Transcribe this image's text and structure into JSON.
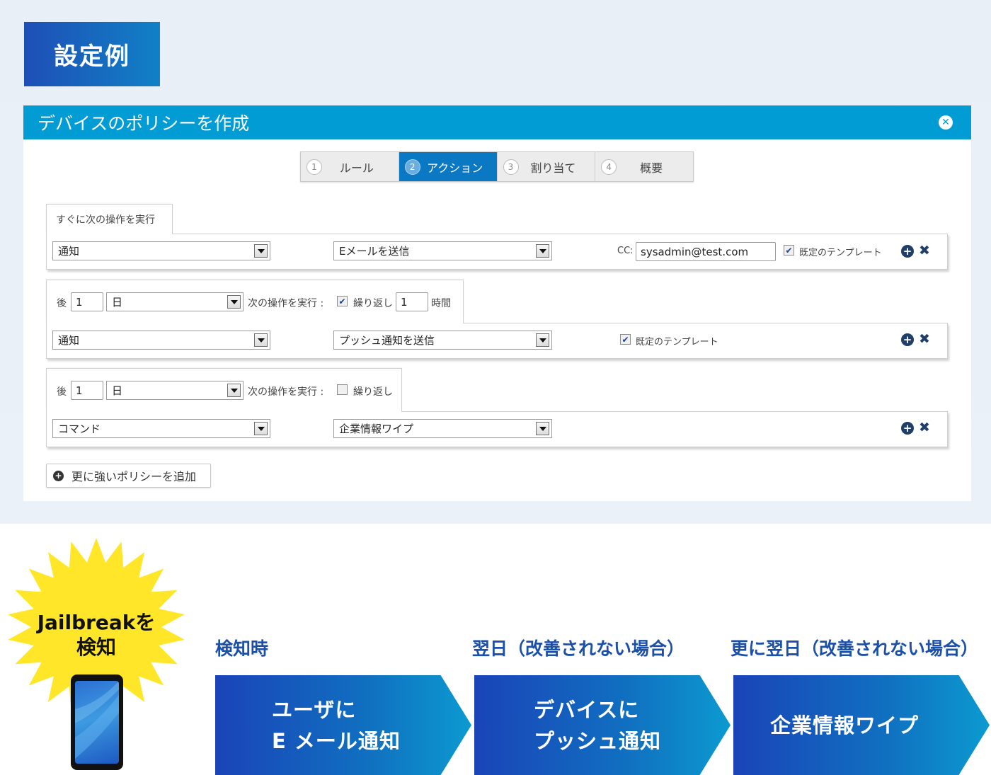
{
  "heading": "設定例",
  "dialog": {
    "title": "デバイスのポリシーを作成",
    "close_icon": "close-icon",
    "steps": [
      {
        "num": "1",
        "label": "ルール",
        "active": false
      },
      {
        "num": "2",
        "label": "アクション",
        "active": true
      },
      {
        "num": "3",
        "label": "割り当て",
        "active": false
      },
      {
        "num": "4",
        "label": "概要",
        "active": false
      }
    ],
    "block1": {
      "tab": "すぐに次の操作を実行",
      "type": "通知",
      "action": "Eメールを送信",
      "cc_label": "CC:",
      "cc_value": "sysadmin@test.com",
      "template_label": "既定のテンプレート",
      "template_checked": true
    },
    "block2": {
      "after_label": "後",
      "after_value": "1",
      "unit": "日",
      "next_label": "次の操作を実行 :",
      "repeat_label": "繰り返し",
      "repeat_checked": true,
      "repeat_value": "1",
      "repeat_unit": "時間",
      "type": "通知",
      "action": "プッシュ通知を送信",
      "template_label": "既定のテンプレート",
      "template_checked": true
    },
    "block3": {
      "after_label": "後",
      "after_value": "1",
      "unit": "日",
      "next_label": "次の操作を実行 :",
      "repeat_label": "繰り返し",
      "repeat_checked": false,
      "type": "コマンド",
      "action": "企業情報ワイプ"
    },
    "add_policy": "更に強いポリシーを追加"
  },
  "bottom": {
    "burst_text_line1": "Jailbreakを",
    "burst_text_line2": "検知",
    "stages": [
      {
        "title": "検知時",
        "line1": "ユーザに",
        "line2": "E メール通知"
      },
      {
        "title": "翌日（改善されない場合）",
        "line1": "デバイスに",
        "line2": "プッシュ通知"
      },
      {
        "title": "更に翌日（改善されない場合）",
        "line1": "企業情報ワイプ",
        "line2": ""
      }
    ],
    "colors": {
      "accent_blue": "#1b4fa8",
      "header_blue": "#009cd3",
      "burst_yellow": "#ffe629"
    }
  }
}
